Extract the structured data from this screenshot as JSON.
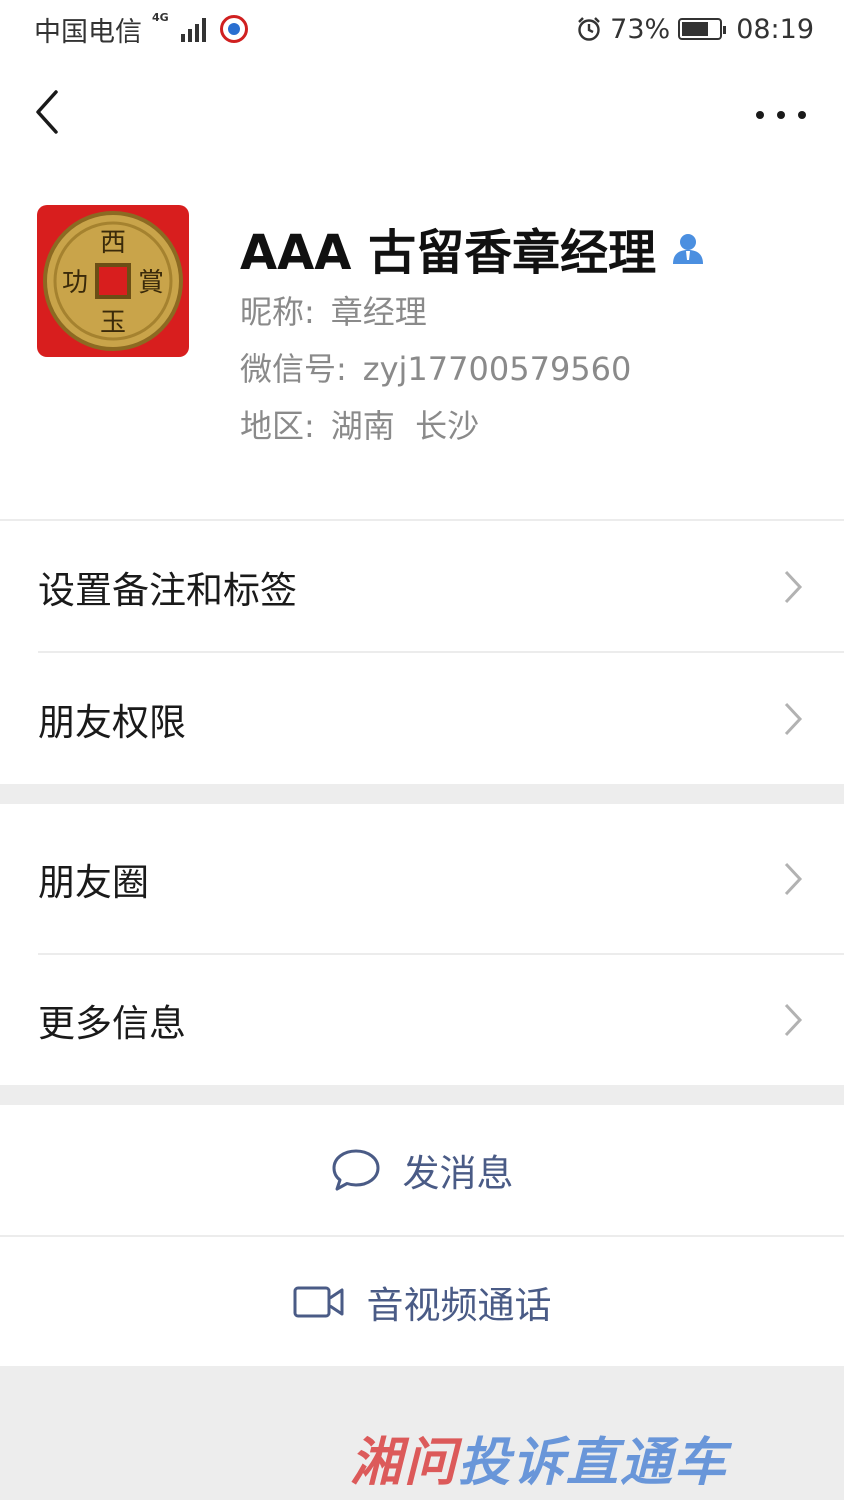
{
  "status_bar": {
    "carrier": "中国电信",
    "network": "4G",
    "alarm_icon": "alarm-clock-icon",
    "battery_percent": "73%",
    "battery_level": 0.73,
    "time": "08:19"
  },
  "nav": {
    "back_icon": "chevron-left-icon",
    "more_icon": "more-dots-icon"
  },
  "profile": {
    "name": "AAA 古留香章经理",
    "nickname_label": "昵称:",
    "nickname": "章经理",
    "wechat_id_label": "微信号:",
    "wechat_id": "zyj17700579560",
    "region_label": "地区:",
    "region": "湖南  长沙",
    "avatar_text": [
      "西",
      "賞",
      "玉",
      "功"
    ]
  },
  "menu": {
    "group1": [
      "设置备注和标签",
      "朋友权限"
    ],
    "group2": [
      "朋友圈",
      "更多信息"
    ]
  },
  "actions": {
    "message": "发消息",
    "call": "音视频通话"
  },
  "watermark": {
    "text_red": "湘问",
    "text_blue": "投诉直通车"
  },
  "colors": {
    "accent_text": "#4a5b86",
    "avatar_bg": "#d81e1e",
    "coin": "#c9a44a"
  }
}
